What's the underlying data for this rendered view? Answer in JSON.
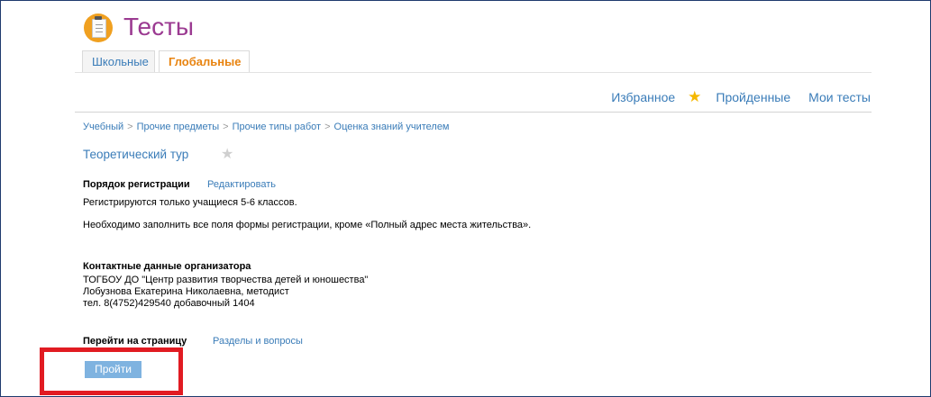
{
  "header": {
    "title": "Тесты",
    "logo_icon": "notepad-icon"
  },
  "tabs": [
    {
      "label": "Школьные",
      "active": false
    },
    {
      "label": "Глобальные",
      "active": true
    }
  ],
  "topnav": {
    "favorites": "Избранное",
    "completed": "Пройденные",
    "my_tests": "Мои тесты",
    "star_icon": "star-icon"
  },
  "breadcrumb": [
    "Учебный",
    "Прочие предметы",
    "Прочие типы работ",
    "Оценка знаний учителем"
  ],
  "breadcrumb_separator": ">",
  "test": {
    "name": "Теоретический тур"
  },
  "registration": {
    "label": "Порядок регистрации",
    "edit_link": "Редактировать",
    "line1": "Регистрируются только учащиеся 5-6 классов.",
    "line2": "Необходимо заполнить все поля формы регистрации, кроме «Полный адрес места жительства»."
  },
  "contacts": {
    "label": "Контактные данные организатора",
    "lines": [
      "ТОГБОУ ДО \"Центр развития творчества детей и юношества\"",
      "Лобузнова Екатерина Николаевна, методист",
      "тел. 8(4752)429540 добавочный 1404"
    ]
  },
  "goto": {
    "label": "Перейти на страницу",
    "link": "Разделы и вопросы"
  },
  "action": {
    "go_button": "Пройти"
  },
  "colors": {
    "title": "#9b3a91",
    "link": "#3a7cb8",
    "active_tab": "#e8830f",
    "star": "#f5b800",
    "button": "#7fb3e0",
    "highlight": "#e11b22"
  }
}
